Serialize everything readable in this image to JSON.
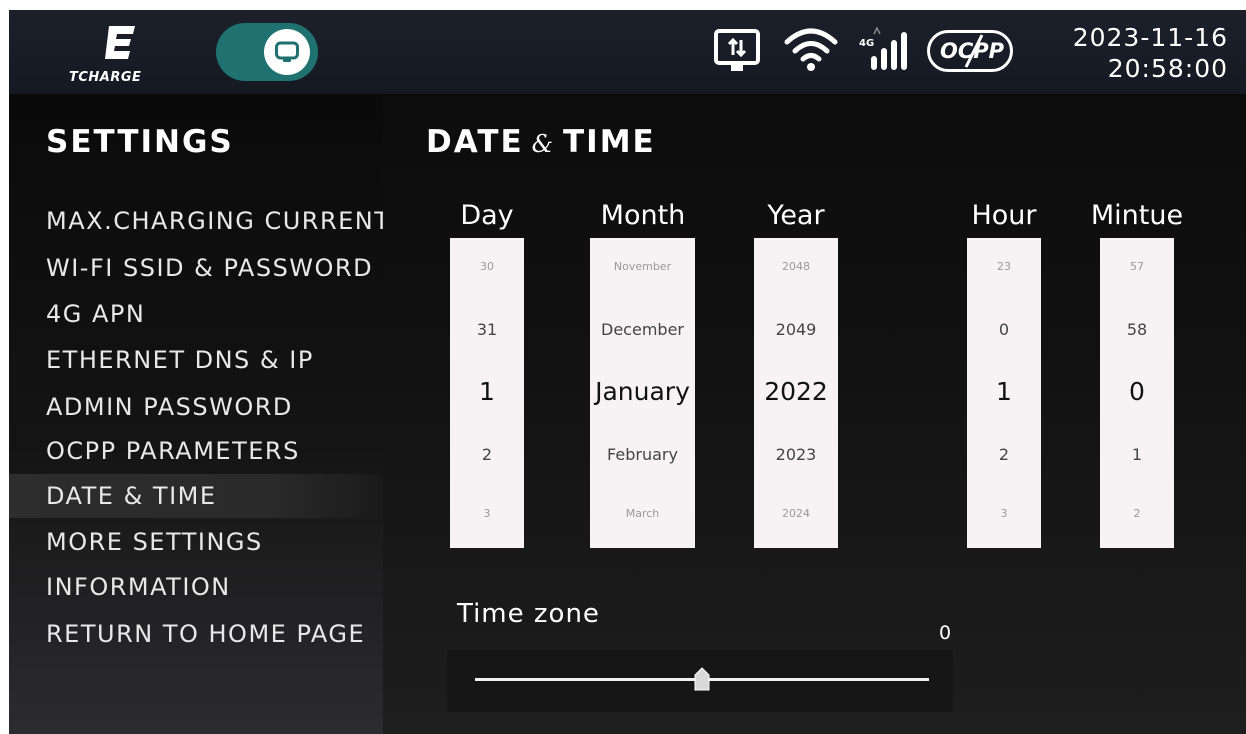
{
  "app": {
    "brand": "TCHARGE"
  },
  "statusbar": {
    "icons": [
      "ethernet-icon",
      "wifi-icon",
      "signal-4g-icon",
      "ocpp-icon"
    ],
    "signal_label": "4G",
    "ocpp_label": "OCPP",
    "date": "2023-11-16",
    "time": "20:58:00"
  },
  "sidebar": {
    "title": "SETTINGS",
    "items": [
      {
        "label": "MAX.CHARGING  CURRENT",
        "active": false
      },
      {
        "label": "WI-FI  SSID  &  PASSWORD",
        "active": false
      },
      {
        "label": "4G  APN",
        "active": false
      },
      {
        "label": "ETHERNET  DNS  &  IP",
        "active": false
      },
      {
        "label": "ADMIN  PASSWORD",
        "active": false
      },
      {
        "label": "OCPP  PARAMETERS",
        "active": false
      },
      {
        "label": "DATE  &  TIME",
        "active": true
      },
      {
        "label": "MORE  SETTINGS",
        "active": false
      },
      {
        "label": "INFORMATION",
        "active": false
      },
      {
        "label": "RETURN  TO  HOME  PAGE",
        "active": false
      }
    ]
  },
  "main": {
    "title_left": "DATE",
    "title_amp": "&",
    "title_right": "TIME",
    "pickers": [
      {
        "label": "Day",
        "values": [
          "30",
          "31",
          "1",
          "2",
          "3"
        ]
      },
      {
        "label": "Month",
        "values": [
          "November",
          "December",
          "January",
          "February",
          "March"
        ]
      },
      {
        "label": "Year",
        "values": [
          "2048",
          "2049",
          "2022",
          "2023",
          "2024"
        ]
      },
      {
        "label": "Hour",
        "values": [
          "23",
          "0",
          "1",
          "2",
          "3"
        ]
      },
      {
        "label": "Mintue",
        "values": [
          "57",
          "58",
          "0",
          "1",
          "2"
        ]
      }
    ],
    "timezone": {
      "label": "Time  zone",
      "value": "0",
      "slider_fraction": 0.5
    }
  },
  "colors": {
    "accent_toggle": "#1f7270",
    "background": "#121212",
    "picker_bg": "#f7f3f4"
  }
}
